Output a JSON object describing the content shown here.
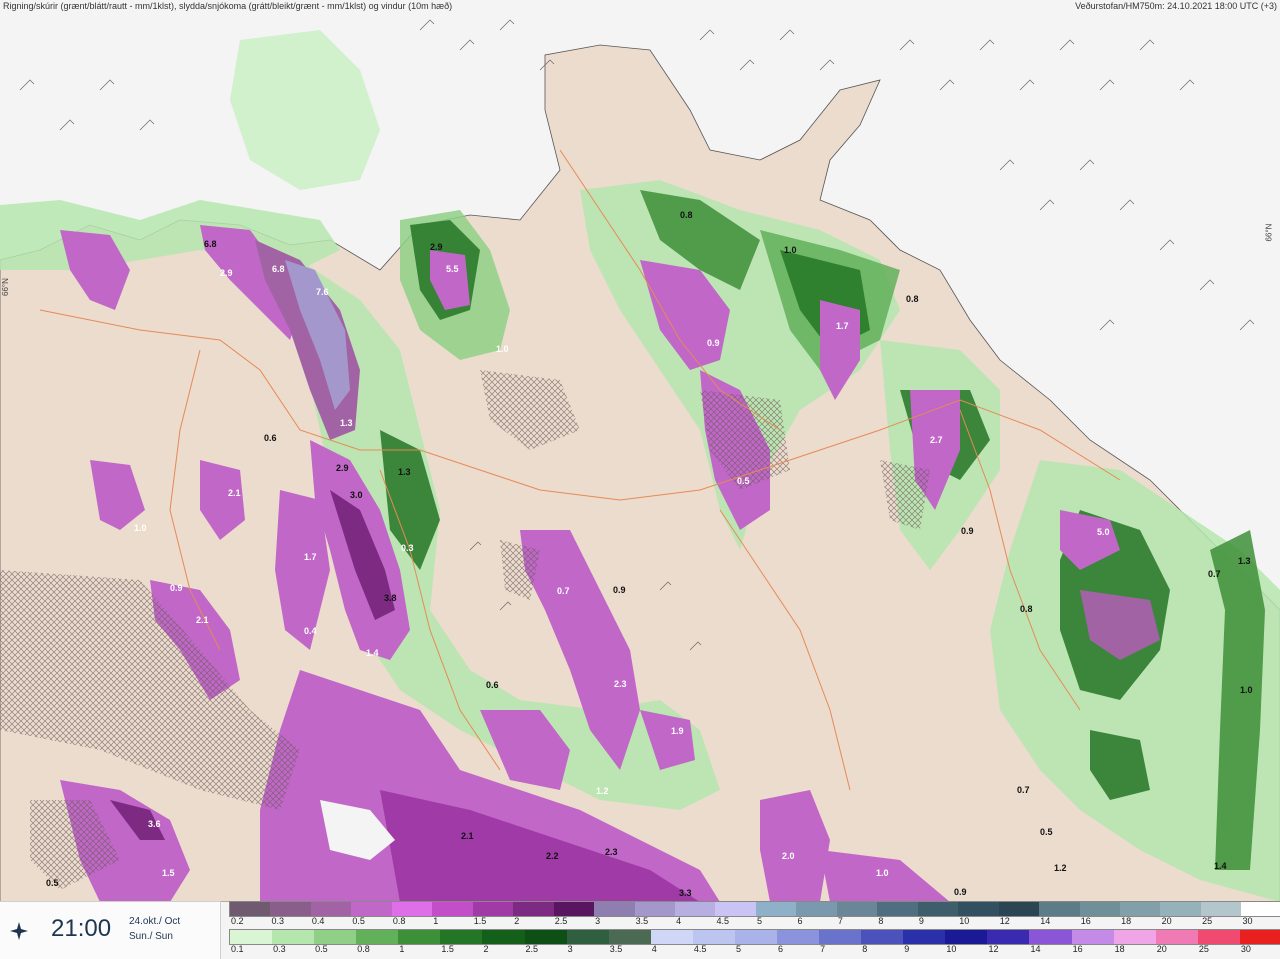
{
  "header": {
    "left_text": "Rigning/skúrir (grænt/blátt/rautt - mm/1klst), slydda/snjókoma (grátt/bleikt/grænt - mm/1klst) og vindur (10m hæð)",
    "right_text": "Veðurstofan/HM750m: 24.10.2021 18:00 UTC (+3)"
  },
  "map": {
    "lat_label_left": "66°N",
    "lat_label_right": "66°N",
    "colors": {
      "sea": "#f4f4f4",
      "land": "#ecdcce",
      "road": "#e58a55"
    },
    "values": [
      {
        "text": "0.8",
        "color": "dark"
      },
      {
        "text": "1.0",
        "color": "dark"
      },
      {
        "text": "0.8",
        "color": "dark"
      },
      {
        "text": "2.9",
        "color": "dark"
      },
      {
        "text": "5.5",
        "color": "light"
      },
      {
        "text": "1.0",
        "color": "light"
      },
      {
        "text": "6.8",
        "color": "dark"
      },
      {
        "text": "2.9",
        "color": "light"
      },
      {
        "text": "6.8",
        "color": "light"
      },
      {
        "text": "7.6",
        "color": "light"
      },
      {
        "text": "1.3",
        "color": "light"
      },
      {
        "text": "2.9",
        "color": "dark"
      },
      {
        "text": "3.0",
        "color": "dark"
      },
      {
        "text": "1.3",
        "color": "dark"
      },
      {
        "text": "3.8",
        "color": "dark"
      },
      {
        "text": "0.6",
        "color": "dark"
      },
      {
        "text": "2.1",
        "color": "light"
      },
      {
        "text": "1.7",
        "color": "light"
      },
      {
        "text": "0.4",
        "color": "light"
      },
      {
        "text": "1.4",
        "color": "light"
      },
      {
        "text": "0.3",
        "color": "light"
      },
      {
        "text": "0.9",
        "color": "light"
      },
      {
        "text": "2.1",
        "color": "light"
      },
      {
        "text": "1.0",
        "color": "light"
      },
      {
        "text": "3.6",
        "color": "light"
      },
      {
        "text": "1.5",
        "color": "light"
      },
      {
        "text": "0.5",
        "color": "dark"
      },
      {
        "text": "0.9",
        "color": "dark"
      },
      {
        "text": "0.7",
        "color": "light"
      },
      {
        "text": "2.3",
        "color": "light"
      },
      {
        "text": "1.9",
        "color": "light"
      },
      {
        "text": "1.2",
        "color": "light"
      },
      {
        "text": "2.1",
        "color": "dark"
      },
      {
        "text": "2.2",
        "color": "dark"
      },
      {
        "text": "2.3",
        "color": "dark"
      },
      {
        "text": "3.3",
        "color": "dark"
      },
      {
        "text": "2.0",
        "color": "light"
      },
      {
        "text": "1.0",
        "color": "light"
      },
      {
        "text": "0.6",
        "color": "dark"
      },
      {
        "text": "0.7",
        "color": "dark"
      },
      {
        "text": "0.9",
        "color": "light"
      },
      {
        "text": "0.5",
        "color": "light"
      },
      {
        "text": "1.7",
        "color": "light"
      },
      {
        "text": "2.7",
        "color": "light"
      },
      {
        "text": "0.9",
        "color": "dark"
      },
      {
        "text": "5.0",
        "color": "light"
      },
      {
        "text": "1.3",
        "color": "dark"
      },
      {
        "text": "0.7",
        "color": "dark"
      },
      {
        "text": "1.0",
        "color": "dark"
      },
      {
        "text": "1.2",
        "color": "dark"
      },
      {
        "text": "0.9",
        "color": "dark"
      },
      {
        "text": "0.8",
        "color": "dark"
      },
      {
        "text": "0.5",
        "color": "dark"
      },
      {
        "text": "1.4",
        "color": "dark"
      }
    ]
  },
  "time": {
    "value": "21:00",
    "date_line1": "24.okt./ Oct",
    "date_line2": "Sun./ Sun"
  },
  "legend_top": {
    "labels": [
      "0.2",
      "0.3",
      "0.4",
      "0.5",
      "0.8",
      "1",
      "1.5",
      "2",
      "2.5",
      "3",
      "3.5",
      "4",
      "4.5",
      "5",
      "6",
      "7",
      "8",
      "9",
      "10",
      "12",
      "14",
      "16",
      "18",
      "20",
      "25",
      "30"
    ],
    "colors": [
      "#705a70",
      "#8a5e8a",
      "#a263a5",
      "#c067c8",
      "#de6fe8",
      "#c24fc8",
      "#a03aa6",
      "#7c2a82",
      "#5a1560",
      "#8f7fb0",
      "#a497cc",
      "#b7aee2",
      "#c9c4f4",
      "#8fb0c9",
      "#7b99ae",
      "#6b8697",
      "#4f6f80",
      "#3f5e6c",
      "#335060",
      "#2b4552",
      "#5c7d88",
      "#6f8f99",
      "#81a0aa",
      "#95b1ba",
      "#b2c6cc",
      "#ffffff"
    ]
  },
  "legend_bottom": {
    "labels": [
      "0.1",
      "0.3",
      "0.5",
      "0.8",
      "1",
      "1.5",
      "2",
      "2.5",
      "3",
      "3.5",
      "4",
      "4.5",
      "5",
      "6",
      "7",
      "8",
      "9",
      "10",
      "12",
      "14",
      "16",
      "18",
      "20",
      "25",
      "30"
    ],
    "colors": [
      "#d9f5d4",
      "#b5e6ae",
      "#8fd086",
      "#62b05a",
      "#3d8f38",
      "#247626",
      "#145f1a",
      "#0d4f14",
      "#2f5f3f",
      "#4a6a54",
      "#d0d6f5",
      "#bcc4f0",
      "#a9b3ea",
      "#8a93dc",
      "#6a73cc",
      "#4b52bb",
      "#2a2faa",
      "#1a1a96",
      "#3a2ab0",
      "#8a55d6",
      "#c48ae8",
      "#f0a6e6",
      "#f07ab4",
      "#f04a70",
      "#e82020"
    ]
  }
}
